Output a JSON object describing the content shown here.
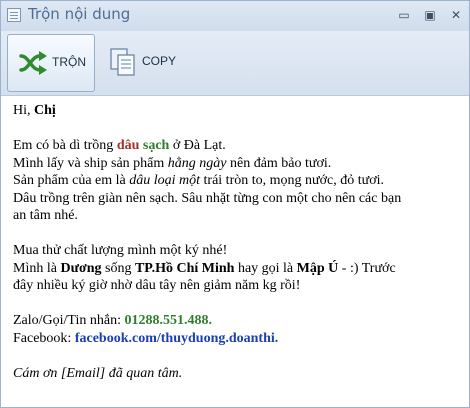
{
  "window": {
    "title": "Trộn nội dung",
    "min_label": "▭",
    "max_label": "▣",
    "close_label": "✕"
  },
  "toolbar": {
    "shuffle_label": "TRỘN",
    "copy_label": "COPY"
  },
  "message": {
    "greeting_prefix": "Hi, ",
    "greeting_name": "Chị",
    "p1_a": "Em có bà dì trồng ",
    "p1_red": "dâu",
    "p1_space": " ",
    "p1_green": "sạch",
    "p1_b": " ở Đà Lạt.",
    "p2_a": "Mình lấy và ship sản phẩm ",
    "p2_i": "hằng ngày",
    "p2_b": " nên đảm bảo tươi.",
    "p3_a": "Sản phẩm của em là ",
    "p3_i": "dâu loại một",
    "p3_b": " trái tròn to, mọng nước, đỏ tươi.",
    "p4": "Dâu trồng trên giàn nên sạch. Sâu nhặt từng con một cho nên các bạn",
    "p4_cont": "an tâm nhé.",
    "p5": "Mua thử chất lượng mình một ký nhé!",
    "p6_a": "Mình là ",
    "p6_name": "Dương",
    "p6_b": " sống ",
    "p6_city": "TP.Hồ Chí Minh",
    "p6_c": " hay gọi là ",
    "p6_nick": "Mập Ú",
    "p6_d": " - :) Trước",
    "p6_cont": "đây nhiều ký giờ nhờ dâu tây nên giảm năm kg rồi!",
    "contact_label": "Zalo/Gọi/Tin nhắn: ",
    "contact_phone": "01288.551.488.",
    "fb_label": "Facebook: ",
    "fb_link": "facebook.com/thuyduong.doanthi.",
    "thanks": "Cám ơn [Email] đã quan tâm."
  },
  "colors": {
    "red_word": "#a0302a",
    "green_word": "#2f7d2f",
    "link_blue": "#1a3fb4",
    "title_text": "#4f6e92"
  },
  "icons": [
    "app-icon",
    "shuffle-icon",
    "copy-icon",
    "minimize-icon",
    "maximize-icon",
    "close-icon"
  ]
}
